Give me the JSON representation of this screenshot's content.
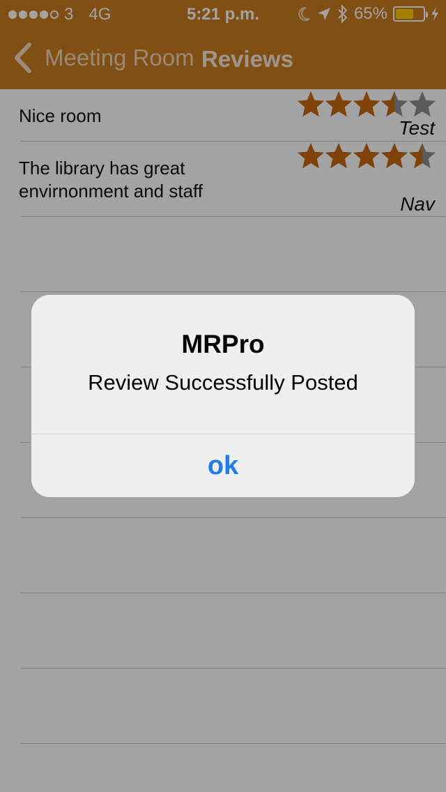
{
  "status_bar": {
    "carrier": "3",
    "network": "4G",
    "time": "5:21 p.m.",
    "battery_percent": "65%",
    "battery_level": 0.65,
    "signal_dots_filled": 4,
    "signal_dots_total": 5,
    "icons": [
      "moon-icon",
      "location-arrow-icon",
      "bluetooth-icon",
      "charging-bolt-icon"
    ]
  },
  "nav": {
    "back_label": "Meeting Room",
    "title": "Reviews"
  },
  "reviews": [
    {
      "text": "Nice room",
      "author": "Test",
      "rating": 3.5,
      "max_rating": 5
    },
    {
      "text": "The library has great envirnonment and staff",
      "author": "Nav",
      "rating": 4.5,
      "max_rating": 5
    }
  ],
  "alert": {
    "title": "MRPro",
    "message": "Review Successfully Posted",
    "button_label": "ok"
  },
  "colors": {
    "brand": "#c87c1f",
    "star_filled": "#c96a0c",
    "star_empty": "#8e8e8e",
    "alert_button": "#1e7cf2"
  }
}
